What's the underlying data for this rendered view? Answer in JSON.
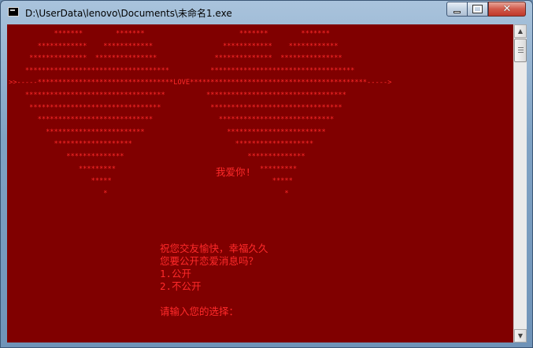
{
  "window": {
    "title": "D:\\UserData\\lenovo\\Documents\\未命名1.exe",
    "icon": "console-app-icon",
    "controls": {
      "minimize": "minimize-icon",
      "maximize": "maximize-icon",
      "close": "close-icon"
    }
  },
  "console": {
    "background": "#800000",
    "text_color": "#ff2a2a",
    "ascii_art": "           *******        *******                       *******        *******\n       ************    ************                 ************    ************\n     **************  ***************              **************  ***************\n    ***********************************          ***********************************\n>>-----*********************************LOVE*******************************************----->\n    **********************************          **********************************\n     ********************************            ********************************\n       ****************************                ****************************\n         ************************                    ************************\n           *******************                         *******************\n              **************                              **************\n                 *********                                   *********\n                    *****                                       *****\n                       *                                           *",
    "love_text": "我爱你!",
    "messages": [
      "祝您交友愉快，幸福久久",
      "您要公开恋爱消息吗？",
      "1.公开",
      "2.不公开",
      "请输入您的选择："
    ]
  },
  "scrollbar": {
    "up": "scroll-up-arrow-icon",
    "down": "scroll-down-arrow-icon"
  }
}
